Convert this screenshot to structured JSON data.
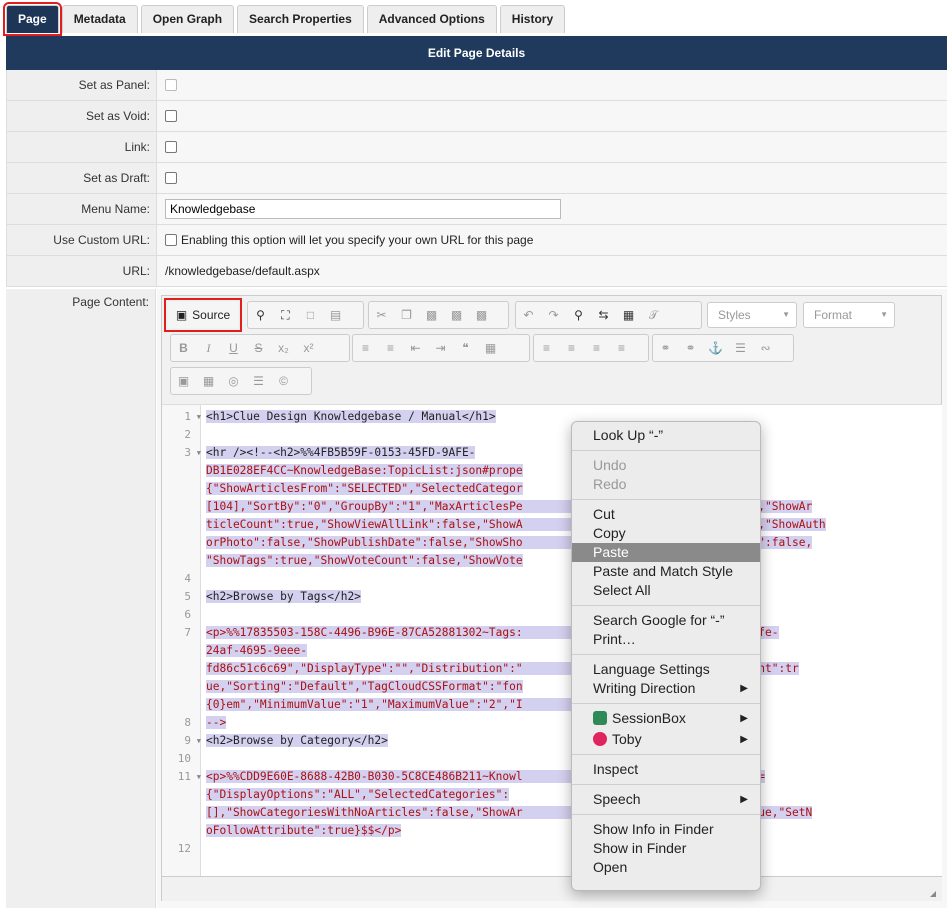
{
  "tabs": [
    "Page",
    "Metadata",
    "Open Graph",
    "Search Properties",
    "Advanced Options",
    "History"
  ],
  "header": {
    "title": "Edit Page Details"
  },
  "form": {
    "set_as_panel": "Set as Panel:",
    "set_as_void": "Set as Void:",
    "link": "Link:",
    "set_as_draft": "Set as Draft:",
    "menu_name_label": "Menu Name:",
    "menu_name_value": "Knowledgebase",
    "use_custom_url_label": "Use Custom URL:",
    "use_custom_url_help": "Enabling this option will let you specify your own URL for this page",
    "url_label": "URL:",
    "url_value": "/knowledgebase/default.aspx",
    "page_content_label": "Page Content:"
  },
  "editor": {
    "source_label": "Source",
    "styles_label": "Styles",
    "format_label": "Format",
    "line_numbers": [
      "1",
      "2",
      "3",
      "4",
      "5",
      "6",
      "7",
      "8",
      "9",
      "10",
      "11",
      "12"
    ],
    "code_lines": [
      "<h1>Clue Design Knowledgebase / Manual</h1>",
      "",
      "<hr /><!--<h2>%%4FB5B59F-0153-45FD-9AFE-",
      "DB1E028EF4CC~KnowledgeBase:TopicList:json#prope",
      "{\"ShowArticlesFrom\":\"SELECTED\",\"SelectedCategor",
      "[104],\"SortBy\":\"0\",\"GroupBy\":\"1\",\"MaxArticlesPe                      oryName\":true,\"ShowAr",
      "ticleCount\":true,\"ShowViewAllLink\":false,\"ShowA                        uthor\":true,\"ShowAuth",
      "orPhoto\":false,\"ShowPublishDate\":false,\"ShowSho                      FeedbackCount\":false,",
      "\"ShowTags\":true,\"ShowVoteCount\":false,\"ShowVote",
      "",
      "<h2>Browse by Tags</h2>",
      "",
      "<p>%%17835503-158C-4496-B96E-87CA52881302~Tags:                     ={\"ID\":\"00c374fe-",
      "24af-4695-9eee-",
      "fd86c51c6c69\",\"DisplayType\":\"\",\"Distribution\":\"                    10\",\"ShowTagCount\":tr",
      "ue,\"Sorting\":\"Default\",\"TagCloudCSSFormat\":\"fon",
      "{0}em\",\"MinimumValue\":\"1\",\"MaximumValue\":\"2\",\"I                      </p>",
      "-->",
      "<h2>Browse by Category</h2>",
      "",
      "<p>%%CDD9E60E-8688-42B0-B030-5C8CE486B211~Knowl                      on#properties=",
      "{\"DisplayOptions\":\"ALL\",\"SelectedCategories\":",
      "[],\"ShowCategoriesWithNoArticles\":false,\"ShowAr                      ewAllLink\":true,\"SetN",
      "oFollowAttribute\":true}$$</p>"
    ]
  },
  "context_menu": {
    "items": [
      {
        "label": "Look Up “-”",
        "state": "normal"
      },
      {
        "label": "Undo",
        "state": "disabled"
      },
      {
        "label": "Redo",
        "state": "disabled"
      },
      {
        "label": "Cut",
        "state": "normal"
      },
      {
        "label": "Copy",
        "state": "normal"
      },
      {
        "label": "Paste",
        "state": "highlighted"
      },
      {
        "label": "Paste and Match Style",
        "state": "normal"
      },
      {
        "label": "Select All",
        "state": "normal"
      },
      {
        "label": "Search Google for “-”",
        "state": "normal"
      },
      {
        "label": "Print…",
        "state": "normal"
      },
      {
        "label": "Language Settings",
        "state": "normal"
      },
      {
        "label": "Writing Direction",
        "state": "submenu"
      },
      {
        "label": "SessionBox",
        "state": "submenu"
      },
      {
        "label": "Toby",
        "state": "submenu"
      },
      {
        "label": "Inspect",
        "state": "normal"
      },
      {
        "label": "Speech",
        "state": "submenu"
      },
      {
        "label": "Show Info in Finder",
        "state": "normal"
      },
      {
        "label": "Show in Finder",
        "state": "normal"
      },
      {
        "label": "Open",
        "state": "normal"
      }
    ]
  },
  "colors": {
    "accent": "#1f3a5c",
    "highlight": "#e21d1d",
    "selection": "#d4d0f0"
  }
}
